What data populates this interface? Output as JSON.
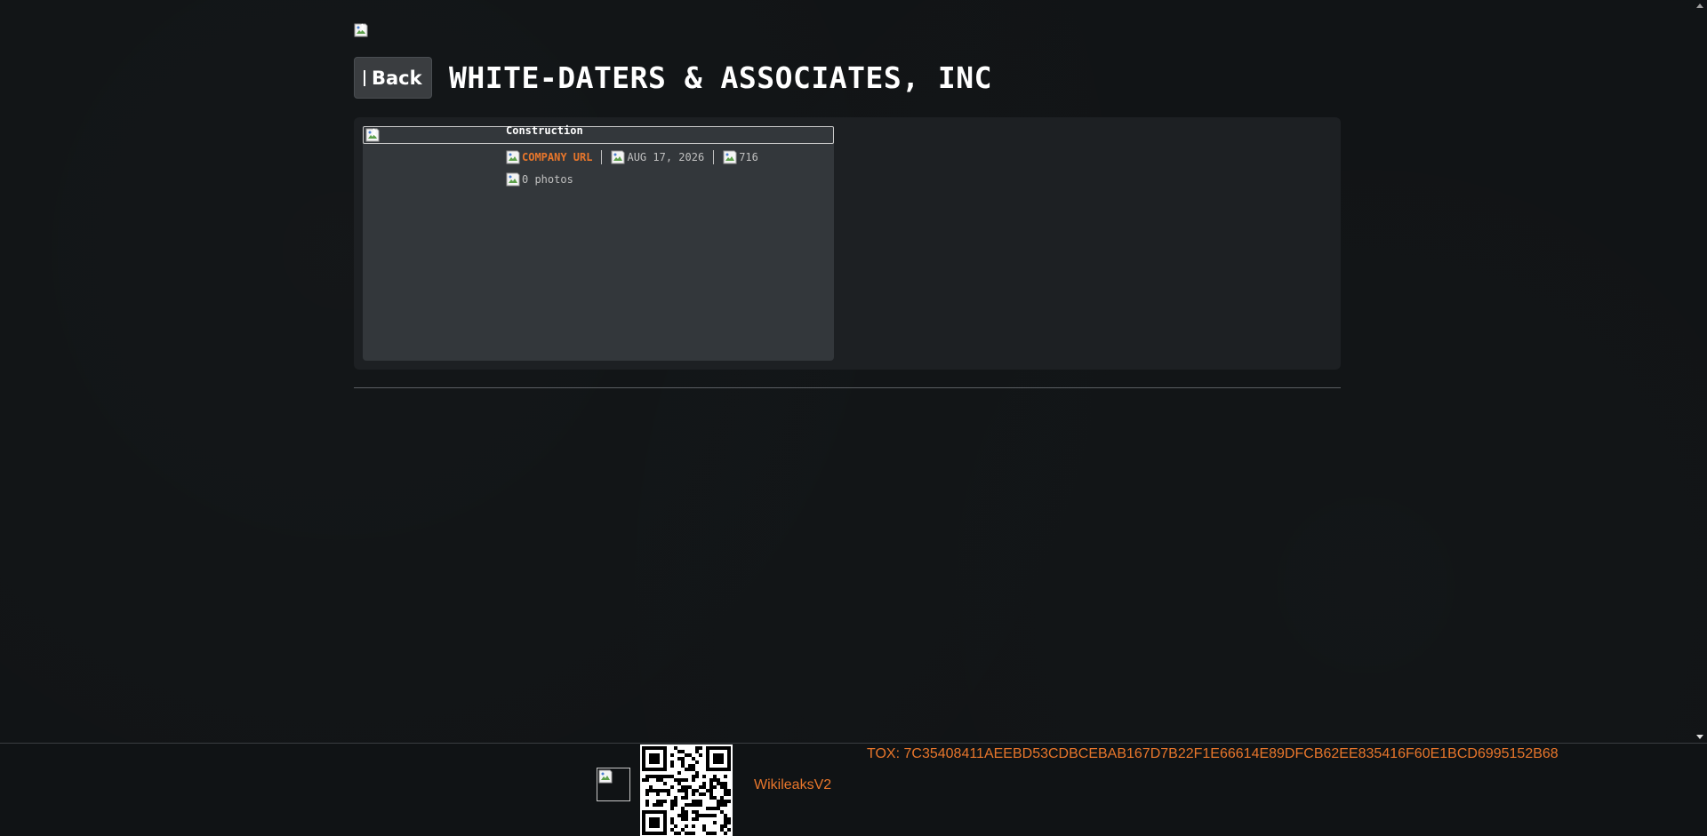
{
  "header": {
    "back_label": "Back",
    "title": "WHITE-DATERS & ASSOCIATES, INC"
  },
  "company": {
    "category": "Construction",
    "url_label": "COMPANY URL",
    "date": "AUG 17, 2026",
    "views": "716",
    "photos": "0 photos"
  },
  "footer": {
    "link_label": "WikileaksV2",
    "tox": "TOX: 7C35408411AEEBD53CDBCEBAB167D7B22F1E66614E89DFCB62EE835416F60E1BCD6995152B68"
  },
  "colors": {
    "accent": "#e8762b",
    "background": "#101315",
    "card": "#1d2023"
  },
  "icons": {
    "broken_image": "broken-image-icon",
    "qr": "qr-code"
  }
}
